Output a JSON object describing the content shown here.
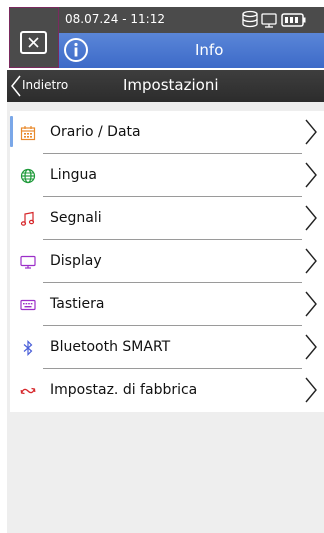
{
  "status": {
    "datetime": "08.07.24 - 11:12"
  },
  "header": {
    "title": "Info"
  },
  "nav": {
    "back_label": "Indietro",
    "title": "Impostazioni"
  },
  "menu": {
    "items": [
      {
        "label": "Orario / Data",
        "icon": "calendar-icon",
        "color": "#e8892a",
        "selected": true
      },
      {
        "label": "Lingua",
        "icon": "globe-icon",
        "color": "#1e9a3a"
      },
      {
        "label": "Segnali",
        "icon": "music-note-icon",
        "color": "#d6262a"
      },
      {
        "label": "Display",
        "icon": "monitor-icon",
        "color": "#9b2ec8"
      },
      {
        "label": "Tastiera",
        "icon": "keyboard-icon",
        "color": "#9b2ec8"
      },
      {
        "label": "Bluetooth SMART",
        "icon": "bluetooth-icon",
        "color": "#4a5fd8"
      },
      {
        "label": "Impostaz. di fabbrica",
        "icon": "factory-reset-icon",
        "color": "#d6262a"
      }
    ]
  }
}
